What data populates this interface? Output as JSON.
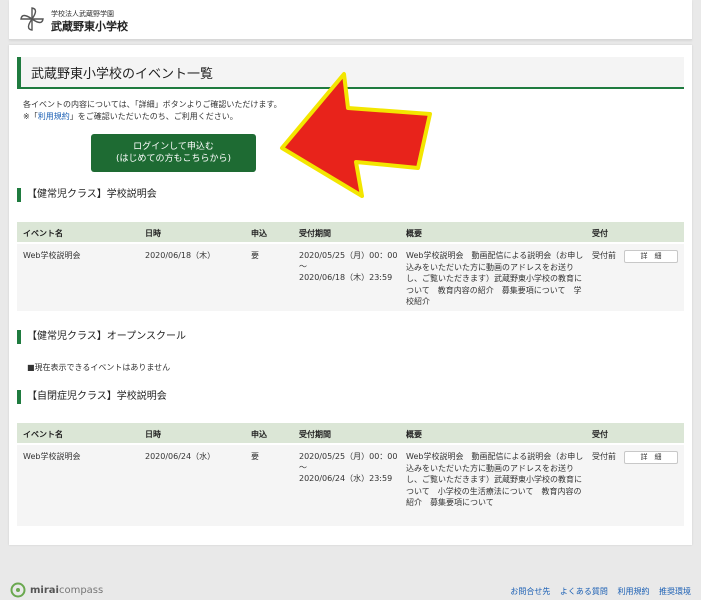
{
  "header": {
    "school_sub": "学校法人武蔵野学園",
    "school_name": "武蔵野東小学校"
  },
  "page": {
    "title": "武蔵野東小学校のイベント一覧",
    "intro_line1": "各イベントの内容については、「詳細」ボタンよりご確認いただけます。",
    "intro_prefix": "※「",
    "intro_link": "利用規約",
    "intro_suffix": "」をご確認いただいたのち、ご利用ください。",
    "login_line1": "ログインして申込む",
    "login_line2": "(はじめての方もこちらから)"
  },
  "table_headers": {
    "name": "イベント名",
    "date": "日時",
    "apply": "申込",
    "period": "受付期間",
    "overview": "概要",
    "status": "受付"
  },
  "sections": [
    {
      "title": "【健常児クラス】学校説明会",
      "event": {
        "name": "Web学校説明会",
        "date": "2020/06/18（木）",
        "apply": "要",
        "period_start": "2020/05/25（月）00：00",
        "period_sep": "～",
        "period_end": "2020/06/18（木）23:59",
        "overview": "Web学校説明会　動画配信による説明会（お申し込みをいただいた方に動画のアドレスをお送りし、ご覧いただきます）武蔵野東小学校の教育について　教育内容の紹介　募集要項について　学校紹介",
        "status": "受付前",
        "detail_label": "詳　細"
      }
    },
    {
      "title": "【健常児クラス】オープンスクール",
      "no_events": "■現在表示できるイベントはありません"
    },
    {
      "title": "【自閉症児クラス】学校説明会",
      "event": {
        "name": "Web学校説明会",
        "date": "2020/06/24（水）",
        "apply": "要",
        "period_start": "2020/05/25（月）00：00",
        "period_sep": "～",
        "period_end": "2020/06/24（水）23:59",
        "overview": "Web学校説明会　動画配信による説明会（お申し込みをいただいた方に動画のアドレスをお送りし、ご覧いただきます）武蔵野東小学校の教育について　小学校の生活療法について　教育内容の紹介　募集要項について",
        "status": "受付前",
        "detail_label": "詳　細"
      }
    }
  ],
  "footer": {
    "brand_bold": "mirai",
    "brand_light": "compass",
    "links": [
      "お問合せ先",
      "よくある質問",
      "利用規約",
      "推奨環境"
    ]
  },
  "colors": {
    "accent_green": "#1f7b3f",
    "button_green": "#1e6b33",
    "table_header_bg": "#dbe6d6",
    "link_blue": "#1a5fb4",
    "arrow_red": "#e8231b",
    "arrow_outline": "#f3e600"
  },
  "icons": {
    "school_logo": "pinwheel-logo-icon",
    "footer_logo": "miraicompass-logo-icon",
    "annotation": "red-arrow-icon"
  }
}
